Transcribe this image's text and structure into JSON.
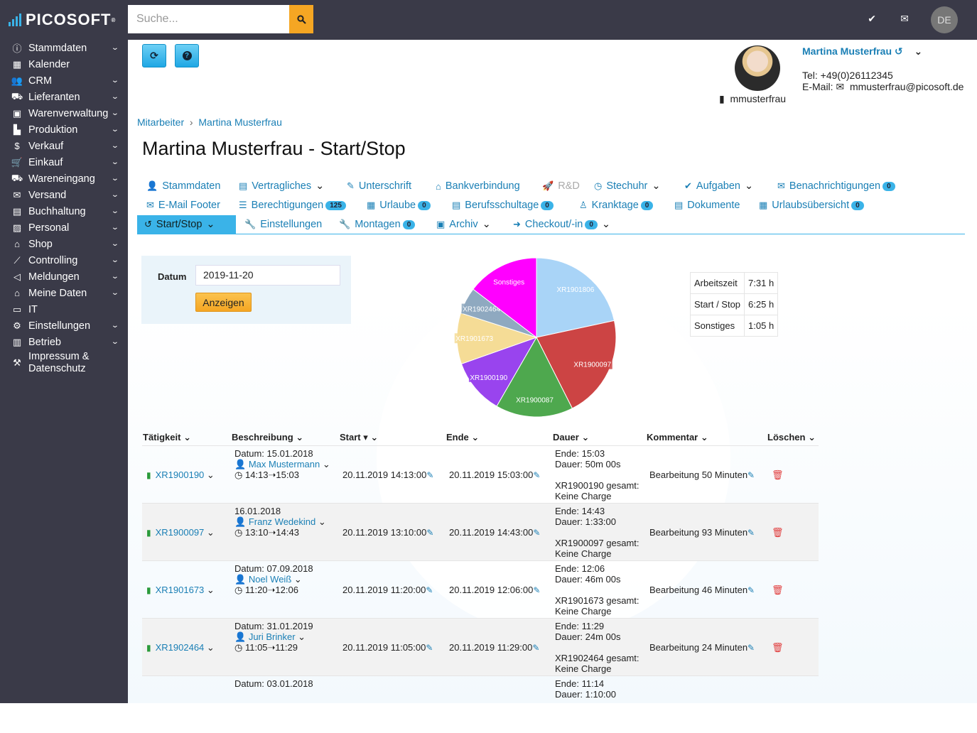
{
  "app": {
    "logo": "PICOSOFT",
    "search_placeholder": "Suche...",
    "lang": "DE"
  },
  "sidebar": {
    "items": [
      {
        "label": "Stammdaten",
        "icon": "info-icon",
        "sub": true
      },
      {
        "label": "Kalender",
        "icon": "calendar-icon",
        "sub": false
      },
      {
        "label": "CRM",
        "icon": "users-icon",
        "sub": true
      },
      {
        "label": "Lieferanten",
        "icon": "truck-icon",
        "sub": true
      },
      {
        "label": "Warenverwaltung",
        "icon": "box-icon",
        "sub": true
      },
      {
        "label": "Produktion",
        "icon": "factory-icon",
        "sub": true
      },
      {
        "label": "Verkauf",
        "icon": "dollar-icon",
        "sub": true
      },
      {
        "label": "Einkauf",
        "icon": "cart-icon",
        "sub": true
      },
      {
        "label": "Wareneingang",
        "icon": "truck-loading-icon",
        "sub": true
      },
      {
        "label": "Versand",
        "icon": "envelope-box-icon",
        "sub": true
      },
      {
        "label": "Buchhaltung",
        "icon": "book-icon",
        "sub": true
      },
      {
        "label": "Personal",
        "icon": "id-card-icon",
        "sub": true
      },
      {
        "label": "Shop",
        "icon": "basket-icon",
        "sub": true
      },
      {
        "label": "Controlling",
        "icon": "chart-icon",
        "sub": true
      },
      {
        "label": "Meldungen",
        "icon": "bullhorn-icon",
        "sub": true
      },
      {
        "label": "Meine Daten",
        "icon": "home-icon",
        "sub": true
      },
      {
        "label": "IT",
        "icon": "laptop-icon",
        "sub": false
      },
      {
        "label": "Einstellungen",
        "icon": "cogs-icon",
        "sub": true
      },
      {
        "label": "Betrieb",
        "icon": "building-icon",
        "sub": true
      },
      {
        "label": "Impressum & Datenschutz",
        "icon": "gavel-icon",
        "sub": false
      }
    ]
  },
  "profile": {
    "name": "Martina Musterfrau",
    "tel": "Tel: +49(0)26112345",
    "email_label": "E-Mail:",
    "email": "mmusterfrau@picosoft.de",
    "user": "mmusterfrau"
  },
  "breadcrumb": {
    "parent": "Mitarbeiter",
    "current": "Martina Musterfrau"
  },
  "title": "Martina Musterfrau - Start/Stop",
  "tabs": {
    "row1": [
      {
        "label": "Stammdaten"
      },
      {
        "label": "Vertragliches"
      },
      {
        "label": "Unterschrift"
      },
      {
        "label": "Bankverbindung"
      },
      {
        "label": "R&D"
      },
      {
        "label": "Stechuhr"
      },
      {
        "label": "Aufgaben"
      },
      {
        "label": "Benachrichtigungen",
        "badge": "0"
      }
    ],
    "row2": [
      {
        "label": "E-Mail Footer"
      },
      {
        "label": "Berechtigungen",
        "badge": "125"
      },
      {
        "label": "Urlaube",
        "badge": "0"
      },
      {
        "label": "Berufsschultage",
        "badge": "0"
      },
      {
        "label": "Kranktage",
        "badge": "0"
      },
      {
        "label": "Dokumente"
      },
      {
        "label": "Urlaubsübersicht",
        "badge": "0"
      }
    ],
    "row3": [
      {
        "label": "Start/Stop"
      },
      {
        "label": "Einstellungen"
      },
      {
        "label": "Montagen",
        "badge": "0"
      },
      {
        "label": "Archiv"
      },
      {
        "label": "Checkout/-in",
        "badge": "0"
      }
    ]
  },
  "form": {
    "date_label": "Datum",
    "date_value": "2019-11-20",
    "submit": "Anzeigen"
  },
  "chart_data": {
    "type": "pie",
    "slices": [
      {
        "label": "XR1901806",
        "value": 96,
        "color": "#a9d4f7"
      },
      {
        "label": "XR1900097",
        "value": 93,
        "color": "#cc4444"
      },
      {
        "label": "XR1900087",
        "value": 70,
        "color": "#4ea84e"
      },
      {
        "label": "XR1900190",
        "value": 50,
        "color": "#9944ee"
      },
      {
        "label": "XR1901673",
        "value": 46,
        "color": "#f5dc96"
      },
      {
        "label": "XR1902464",
        "value": 24,
        "color": "#8fa9c0"
      },
      {
        "label": "Sonstiges",
        "value": 65,
        "color": "#ff00ff"
      }
    ]
  },
  "summary": [
    {
      "label": "Arbeitszeit",
      "value": "7:31 h"
    },
    {
      "label": "Start / Stop",
      "value": "6:25 h"
    },
    {
      "label": "Sonstiges",
      "value": "1:05 h"
    }
  ],
  "grid": {
    "headers": [
      "Tätigkeit",
      "Beschreibung",
      "Start",
      "Ende",
      "Dauer",
      "Kommentar",
      "Löschen"
    ],
    "rows": [
      {
        "id": "XR1900190",
        "date": "Datum: 15.01.2018",
        "person": "Max Mustermann",
        "span": "14:13➝15:03",
        "start": "20.11.2019 14:13:00",
        "end": "20.11.2019 15:03:00",
        "d1": "Ende: 15:03",
        "d2": "Dauer: 50m 00s",
        "d3": "XR1900190 gesamt:",
        "d4": "Keine Charge",
        "comment": "Bearbeitung 50 Minuten"
      },
      {
        "id": "XR1900097",
        "date": "16.01.2018",
        "person": "Franz Wedekind",
        "span": "13:10➝14:43",
        "start": "20.11.2019 13:10:00",
        "end": "20.11.2019 14:43:00",
        "d1": "Ende: 14:43",
        "d2": "Dauer: 1:33:00",
        "d3": "XR1900097 gesamt:",
        "d4": "Keine Charge",
        "comment": "Bearbeitung 93 Minuten"
      },
      {
        "id": "XR1901673",
        "date": "Datum: 07.09.2018",
        "person": "Noel Weiß",
        "span": "11:20➝12:06",
        "start": "20.11.2019 11:20:00",
        "end": "20.11.2019 12:06:00",
        "d1": "Ende: 12:06",
        "d2": "Dauer: 46m 00s",
        "d3": "XR1901673 gesamt:",
        "d4": "Keine Charge",
        "comment": "Bearbeitung 46 Minuten"
      },
      {
        "id": "XR1902464",
        "date": "Datum: 31.01.2019",
        "person": "Juri Brinker",
        "span": "11:05➝11:29",
        "start": "20.11.2019 11:05:00",
        "end": "20.11.2019 11:29:00",
        "d1": "Ende: 11:29",
        "d2": "Dauer: 24m 00s",
        "d3": "XR1902464 gesamt:",
        "d4": "Keine Charge",
        "comment": "Bearbeitung 24 Minuten"
      },
      {
        "id": "",
        "date": "Datum: 03.01.2018",
        "person": "",
        "span": "",
        "start": "",
        "end": "",
        "d1": "Ende: 11:14",
        "d2": "Dauer: 1:10:00",
        "d3": "",
        "d4": "",
        "comment": ""
      }
    ]
  }
}
